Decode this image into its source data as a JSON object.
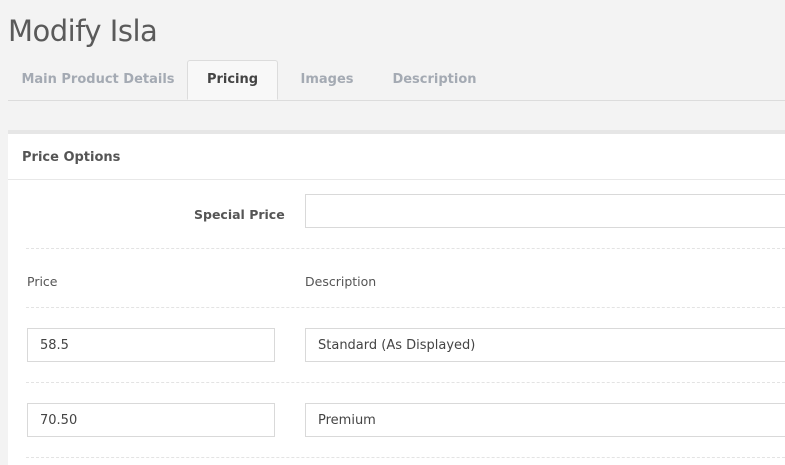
{
  "page": {
    "title": "Modify Isla"
  },
  "tabs": [
    {
      "label": "Main Product Details",
      "active": false
    },
    {
      "label": "Pricing",
      "active": true
    },
    {
      "label": "Images",
      "active": false
    },
    {
      "label": "Description",
      "active": false
    }
  ],
  "price_options": {
    "title": "Price Options",
    "special_price": {
      "label": "Special Price",
      "value": ""
    },
    "columns": {
      "price": "Price",
      "description": "Description"
    },
    "rows": [
      {
        "price": "58.5",
        "description": "Standard (As Displayed)"
      },
      {
        "price": "70.50",
        "description": "Premium"
      }
    ]
  },
  "colors": {
    "background": "#f3f3f3",
    "panel": "#ffffff",
    "tab_inactive_text": "#a4aab3",
    "tab_active_text": "#444444"
  }
}
